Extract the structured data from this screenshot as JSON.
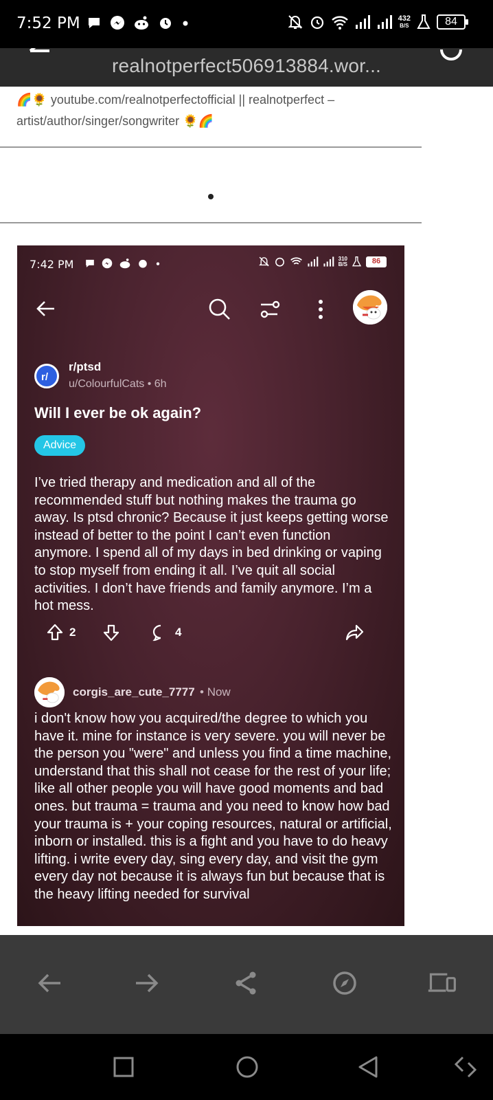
{
  "status_bar": {
    "time": "7:52 PM",
    "netspeed": "432",
    "netspeed_unit": "B/S",
    "battery": "84"
  },
  "browser": {
    "url": "realnotperfect506913884.wor..."
  },
  "page": {
    "bio_line1": "youtube.com/realnotperfectofficial || realnotperfect –",
    "bio_line2": "artist/author/singer/songwriter"
  },
  "embed": {
    "status_time": "7:42 PM",
    "netspeed": "310",
    "netspeed_unit": "B/S",
    "battery": "86",
    "subreddit": "r/ptsd",
    "author": "u/ColourfulCats",
    "age": "6h",
    "title": "Will I ever be ok again?",
    "flair": "Advice",
    "body": "I’ve tried therapy and medication and all of the recommended stuff but nothing makes the trauma go away. Is ptsd chronic? Because it just keeps getting worse instead of better to the point I can’t even function anymore. I spend all of my days in bed drinking or vaping to stop myself from ending it all. I’ve quit all social activities. I don’t have friends and family anymore. I’m a hot mess.",
    "upvotes": "2",
    "comments": "4",
    "comment": {
      "user": "corgis_are_cute_7777",
      "time": "Now",
      "text": "i don't know how you acquired/the degree to which you have it. mine for instance is very severe. you will never be the person you \"were\" and unless you find a time machine, understand that this shall not cease for the rest of your life; like all other people you will have good moments and bad ones. but trauma = trauma and you need to know how bad your trauma is + your coping resources, natural or artificial, inborn or installed. this is a fight and you have to do heavy lifting. i write every day, sing every day, and visit the gym every day not because it is always fun but because that is the heavy lifting needed for survival"
    }
  },
  "colors": {
    "embed_bg": "#48222d",
    "flair": "#24c6e6",
    "subreddit_icon": "#2d5fe0",
    "browser_bar": "#2b2b2b",
    "browser_bottom": "#3a3a3a"
  }
}
